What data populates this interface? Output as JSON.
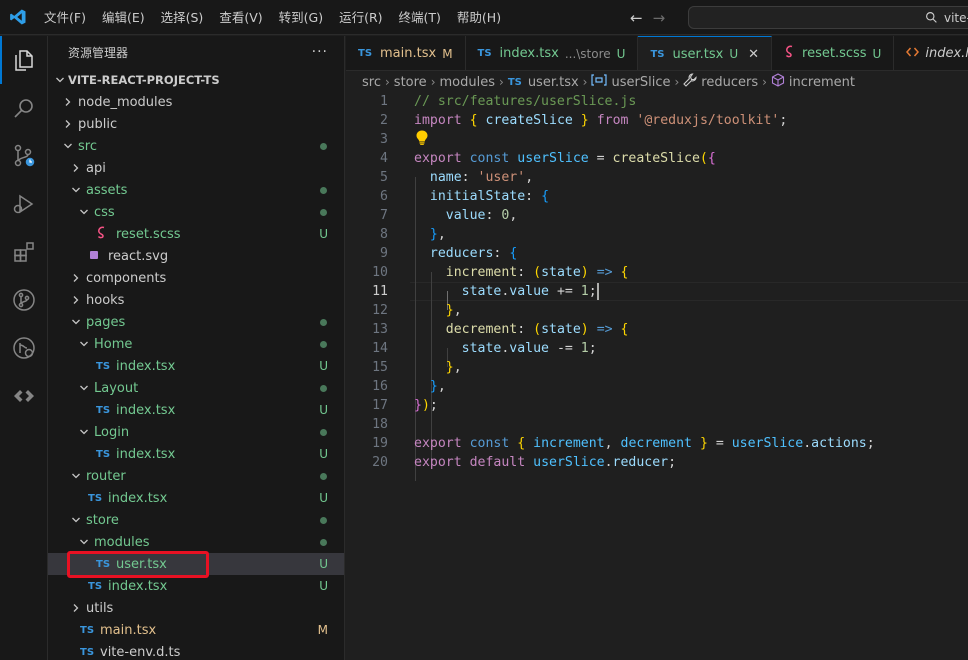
{
  "menu": [
    "文件(F)",
    "编辑(E)",
    "选择(S)",
    "查看(V)",
    "转到(G)",
    "运行(R)",
    "终端(T)",
    "帮助(H)"
  ],
  "search": {
    "text": "vite-"
  },
  "explorer": {
    "title": "资源管理器",
    "more": "···",
    "project": "VITE-REACT-PROJECT-TS",
    "tree": [
      {
        "label": "node_modules",
        "type": "folder",
        "open": false,
        "depth": 1,
        "color": "def"
      },
      {
        "label": "public",
        "type": "folder",
        "open": false,
        "depth": 1,
        "color": "def"
      },
      {
        "label": "src",
        "type": "folder",
        "open": true,
        "depth": 1,
        "color": "git",
        "dot": true
      },
      {
        "label": "api",
        "type": "folder",
        "open": false,
        "depth": 2,
        "color": "def"
      },
      {
        "label": "assets",
        "type": "folder",
        "open": true,
        "depth": 2,
        "color": "git",
        "dot": true
      },
      {
        "label": "css",
        "type": "folder",
        "open": true,
        "depth": 3,
        "color": "git",
        "dot": true
      },
      {
        "label": "reset.scss",
        "type": "scss",
        "depth": 4,
        "color": "git",
        "badge": "U"
      },
      {
        "label": "react.svg",
        "type": "svg",
        "depth": 3,
        "color": "def"
      },
      {
        "label": "components",
        "type": "folder",
        "open": false,
        "depth": 2,
        "color": "def"
      },
      {
        "label": "hooks",
        "type": "folder",
        "open": false,
        "depth": 2,
        "color": "def"
      },
      {
        "label": "pages",
        "type": "folder",
        "open": true,
        "depth": 2,
        "color": "git",
        "dot": true
      },
      {
        "label": "Home",
        "type": "folder",
        "open": true,
        "depth": 3,
        "color": "git",
        "dot": true
      },
      {
        "label": "index.tsx",
        "type": "ts",
        "depth": 4,
        "color": "git",
        "badge": "U"
      },
      {
        "label": "Layout",
        "type": "folder",
        "open": true,
        "depth": 3,
        "color": "git",
        "dot": true
      },
      {
        "label": "index.tsx",
        "type": "ts",
        "depth": 4,
        "color": "git",
        "badge": "U"
      },
      {
        "label": "Login",
        "type": "folder",
        "open": true,
        "depth": 3,
        "color": "git",
        "dot": true
      },
      {
        "label": "index.tsx",
        "type": "ts",
        "depth": 4,
        "color": "git",
        "badge": "U"
      },
      {
        "label": "router",
        "type": "folder",
        "open": true,
        "depth": 2,
        "color": "git",
        "dot": true
      },
      {
        "label": "index.tsx",
        "type": "ts",
        "depth": 3,
        "color": "git",
        "badge": "U"
      },
      {
        "label": "store",
        "type": "folder",
        "open": true,
        "depth": 2,
        "color": "git",
        "dot": true
      },
      {
        "label": "modules",
        "type": "folder",
        "open": true,
        "depth": 3,
        "color": "git",
        "dot": true
      },
      {
        "label": "user.tsx",
        "type": "ts",
        "depth": 4,
        "color": "git",
        "badge": "U",
        "selected": true
      },
      {
        "label": "index.tsx",
        "type": "ts",
        "depth": 3,
        "color": "git",
        "badge": "U"
      },
      {
        "label": "utils",
        "type": "folder",
        "open": false,
        "depth": 2,
        "color": "def"
      },
      {
        "label": "main.tsx",
        "type": "ts",
        "depth": 2,
        "color": "mod",
        "badge": "M"
      },
      {
        "label": "vite-env.d.ts",
        "type": "ts",
        "depth": 2,
        "color": "def"
      }
    ]
  },
  "tabs": [
    {
      "label": "main.tsx",
      "desc": "",
      "status": "M",
      "color": "#e2c08d",
      "icon": "TS",
      "active": false
    },
    {
      "label": "index.tsx",
      "desc": "...\\store",
      "status": "U",
      "color": "#73c991",
      "icon": "TS",
      "active": false
    },
    {
      "label": "user.tsx",
      "desc": "",
      "status": "U",
      "color": "#73c991",
      "icon": "TS",
      "active": true
    },
    {
      "label": "reset.scss",
      "desc": "",
      "status": "U",
      "color": "#73c991",
      "icon": "scss",
      "active": false
    },
    {
      "label": "index.html",
      "desc": "",
      "status": "",
      "color": "#cccccc",
      "icon": "html",
      "active": false
    }
  ],
  "breadcrumb": [
    {
      "label": "src",
      "icon": ""
    },
    {
      "label": "store",
      "icon": ""
    },
    {
      "label": "modules",
      "icon": ""
    },
    {
      "label": "user.tsx",
      "icon": "TS"
    },
    {
      "label": "userSlice",
      "icon": "var"
    },
    {
      "label": "reducers",
      "icon": "wrench"
    },
    {
      "label": "increment",
      "icon": "cube"
    }
  ],
  "editor": {
    "current_line": 11,
    "lines": [
      [
        [
          "// src/features/userSlice.js",
          "com"
        ]
      ],
      [
        [
          "import",
          "kw2"
        ],
        [
          " ",
          "p"
        ],
        [
          "{",
          "b1"
        ],
        [
          " ",
          "p"
        ],
        [
          "createSlice",
          "var"
        ],
        [
          " ",
          "p"
        ],
        [
          "}",
          "b1"
        ],
        [
          " ",
          "p"
        ],
        [
          "from",
          "kw2"
        ],
        [
          " ",
          "p"
        ],
        [
          "'@reduxjs/toolkit'",
          "str"
        ],
        [
          ";",
          "p"
        ]
      ],
      [],
      [
        [
          "export",
          "kw2"
        ],
        [
          " ",
          "p"
        ],
        [
          "const",
          "kw"
        ],
        [
          " ",
          "p"
        ],
        [
          "userSlice",
          "cst"
        ],
        [
          " = ",
          "p"
        ],
        [
          "createSlice",
          "fn"
        ],
        [
          "(",
          "b1"
        ],
        [
          "{",
          "b2"
        ]
      ],
      [
        [
          "  ",
          "p"
        ],
        [
          "name",
          "var"
        ],
        [
          ": ",
          "p"
        ],
        [
          "'user'",
          "str"
        ],
        [
          ",",
          "p"
        ]
      ],
      [
        [
          "  ",
          "p"
        ],
        [
          "initialState",
          "var"
        ],
        [
          ": ",
          "p"
        ],
        [
          "{",
          "b3"
        ]
      ],
      [
        [
          "    ",
          "p"
        ],
        [
          "value",
          "var"
        ],
        [
          ": ",
          "p"
        ],
        [
          "0",
          "num"
        ],
        [
          ",",
          "p"
        ]
      ],
      [
        [
          "  ",
          "p"
        ],
        [
          "}",
          "b3"
        ],
        [
          ",",
          "p"
        ]
      ],
      [
        [
          "  ",
          "p"
        ],
        [
          "reducers",
          "var"
        ],
        [
          ": ",
          "p"
        ],
        [
          "{",
          "b3"
        ]
      ],
      [
        [
          "    ",
          "p"
        ],
        [
          "increment",
          "fn"
        ],
        [
          ": ",
          "p"
        ],
        [
          "(",
          "b1"
        ],
        [
          "state",
          "var"
        ],
        [
          ")",
          "b1"
        ],
        [
          " ",
          "p"
        ],
        [
          "=>",
          "kw"
        ],
        [
          " ",
          "p"
        ],
        [
          "{",
          "b1"
        ]
      ],
      [
        [
          "      ",
          "p"
        ],
        [
          "state",
          "var"
        ],
        [
          ".",
          "p"
        ],
        [
          "value",
          "var"
        ],
        [
          " += ",
          "p"
        ],
        [
          "1",
          "num"
        ],
        [
          ";",
          "p"
        ]
      ],
      [
        [
          "    ",
          "p"
        ],
        [
          "}",
          "b1"
        ],
        [
          ",",
          "p"
        ]
      ],
      [
        [
          "    ",
          "p"
        ],
        [
          "decrement",
          "fn"
        ],
        [
          ": ",
          "p"
        ],
        [
          "(",
          "b1"
        ],
        [
          "state",
          "var"
        ],
        [
          ")",
          "b1"
        ],
        [
          " ",
          "p"
        ],
        [
          "=>",
          "kw"
        ],
        [
          " ",
          "p"
        ],
        [
          "{",
          "b1"
        ]
      ],
      [
        [
          "      ",
          "p"
        ],
        [
          "state",
          "var"
        ],
        [
          ".",
          "p"
        ],
        [
          "value",
          "var"
        ],
        [
          " -= ",
          "p"
        ],
        [
          "1",
          "num"
        ],
        [
          ";",
          "p"
        ]
      ],
      [
        [
          "    ",
          "p"
        ],
        [
          "}",
          "b1"
        ],
        [
          ",",
          "p"
        ]
      ],
      [
        [
          "  ",
          "p"
        ],
        [
          "}",
          "b3"
        ],
        [
          ",",
          "p"
        ]
      ],
      [
        [
          "}",
          "b2"
        ],
        [
          ")",
          "b1"
        ],
        [
          ";",
          "p"
        ]
      ],
      [],
      [
        [
          "export",
          "kw2"
        ],
        [
          " ",
          "p"
        ],
        [
          "const",
          "kw"
        ],
        [
          " ",
          "p"
        ],
        [
          "{",
          "b1"
        ],
        [
          " ",
          "p"
        ],
        [
          "increment",
          "cst"
        ],
        [
          ", ",
          "p"
        ],
        [
          "decrement",
          "cst"
        ],
        [
          " ",
          "p"
        ],
        [
          "}",
          "b1"
        ],
        [
          " = ",
          "p"
        ],
        [
          "userSlice",
          "cst"
        ],
        [
          ".",
          "p"
        ],
        [
          "actions",
          "var"
        ],
        [
          ";",
          "p"
        ]
      ],
      [
        [
          "export",
          "kw2"
        ],
        [
          " ",
          "p"
        ],
        [
          "default",
          "kw2"
        ],
        [
          " ",
          "p"
        ],
        [
          "userSlice",
          "cst"
        ],
        [
          ".",
          "p"
        ],
        [
          "reducer",
          "var"
        ],
        [
          ";",
          "p"
        ]
      ]
    ]
  }
}
